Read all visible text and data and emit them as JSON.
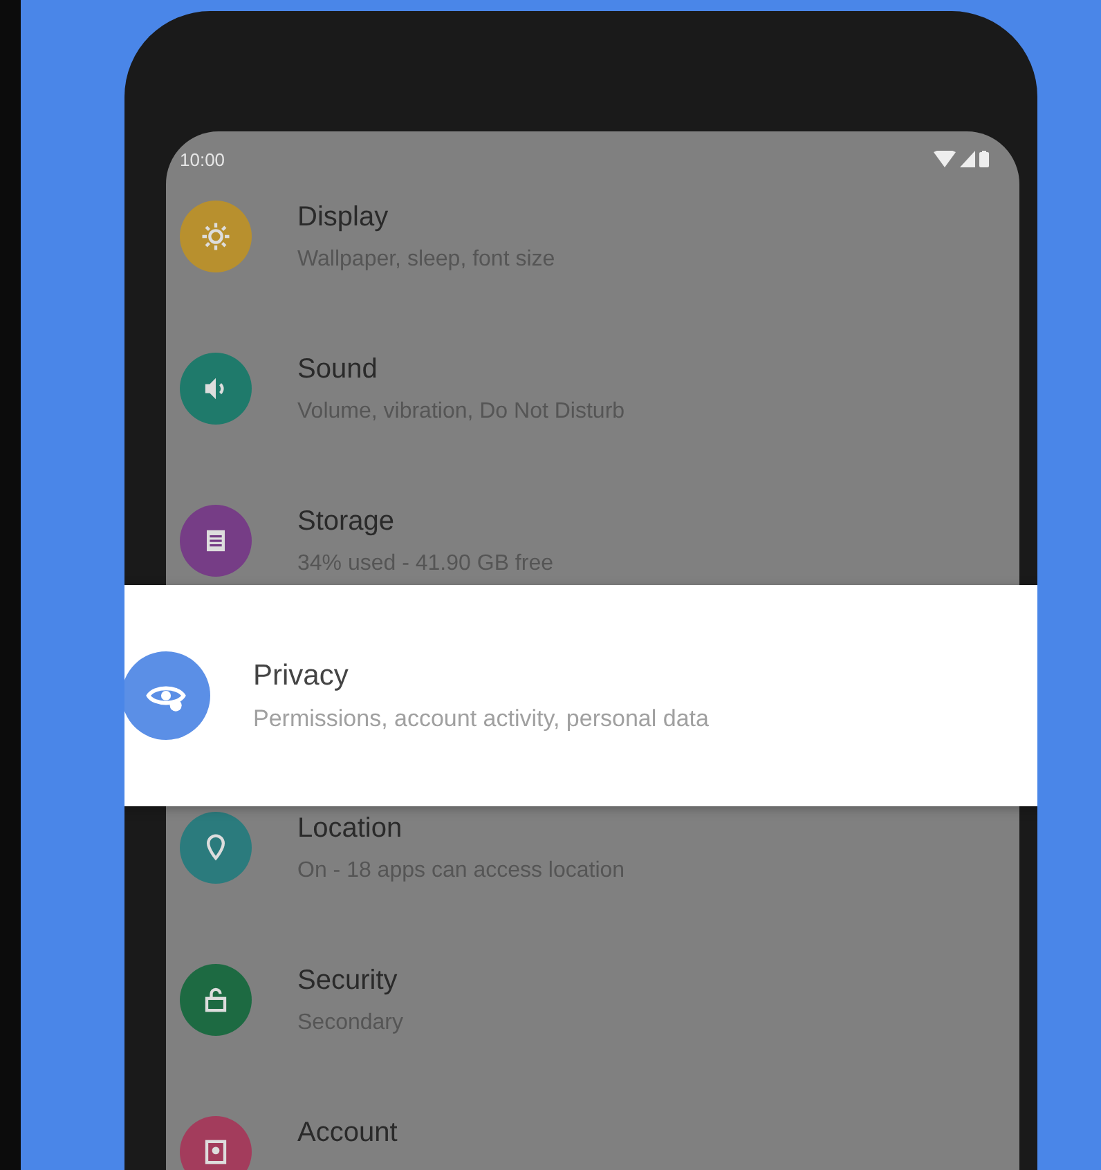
{
  "status_bar": {
    "time": "10:00"
  },
  "settings": [
    {
      "kind": "row",
      "title": "Display",
      "subtitle": "Wallpaper, sleep, font size",
      "color": "#b8902e"
    },
    {
      "kind": "row",
      "title": "Sound",
      "subtitle": "Volume, vibration, Do Not Disturb",
      "color": "#1f7a6b"
    },
    {
      "kind": "row",
      "title": "Storage",
      "subtitle": "34% used - 41.90 GB free",
      "color": "#763d86"
    },
    {
      "kind": "card",
      "title": "Privacy",
      "subtitle": "Permissions, account activity, personal data",
      "color": "#5b8fe6"
    },
    {
      "kind": "row",
      "title": "Location",
      "subtitle": "On - 18 apps can access location",
      "color": "#2b7b7d"
    },
    {
      "kind": "row",
      "title": "Security",
      "subtitle": "Secondary",
      "color": "#1d6a42"
    },
    {
      "kind": "row",
      "title": "Account",
      "color": "#a33c5c"
    }
  ]
}
